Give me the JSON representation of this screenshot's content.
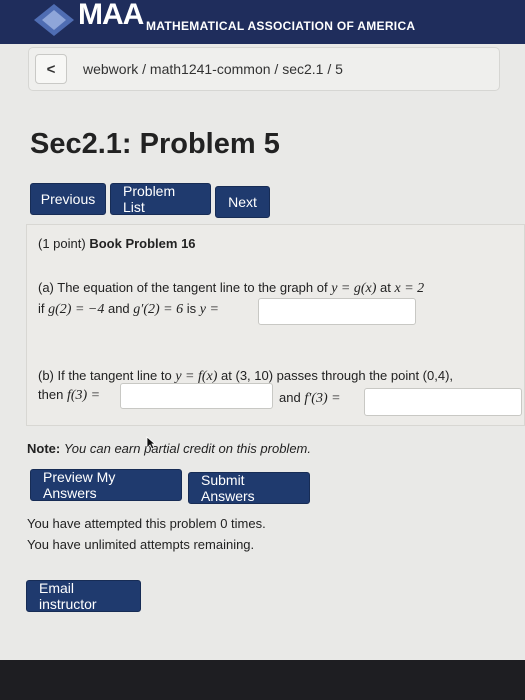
{
  "header": {
    "logo_text": "MAA",
    "org_name": "MATHEMATICAL ASSOCIATION OF AMERICA"
  },
  "breadcrumb": {
    "back_label": "<",
    "path": "webwork / math1241-common / sec2.1 / 5"
  },
  "page_title": "Sec2.1: Problem 5",
  "nav": {
    "previous": "Previous",
    "problem_list": "Problem List",
    "next": "Next"
  },
  "problem": {
    "points": "(1 point)",
    "heading": "Book Problem 16",
    "part_a": {
      "line1_pre": "(a) The equation of the tangent line to the graph of",
      "line1_math1": "y = g(x)",
      "line1_mid": "at",
      "line1_math2": "x = 2",
      "line2_pre": "if",
      "line2_math1": "g(2) = −4",
      "line2_mid": "and",
      "line2_math2": "g′(2) = 6",
      "line2_post": "is",
      "line2_math3": "y =",
      "answer_value": ""
    },
    "part_b": {
      "line1_pre": "(b) If the tangent line to",
      "line1_math": "y = f(x)",
      "line1_post": "at (3, 10) passes through the point (0,4),",
      "line2_pre": "then",
      "line2_math1": "f(3) =",
      "line2_mid": "and",
      "line2_math2": "f′(3) =",
      "answer1_value": "",
      "answer2_value": ""
    }
  },
  "note": {
    "label": "Note:",
    "text": "You can earn partial credit on this problem."
  },
  "actions": {
    "preview": "Preview My Answers",
    "submit": "Submit Answers"
  },
  "attempts": {
    "line1": "You have attempted this problem 0 times.",
    "line2": "You have unlimited attempts remaining."
  },
  "email_button": "Email instructor",
  "colors": {
    "header_bg": "#1f2d5c",
    "button_bg": "#1f3a6e"
  }
}
